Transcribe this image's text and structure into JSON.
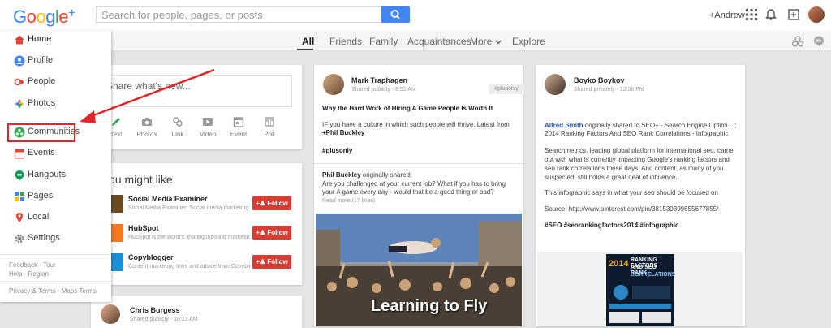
{
  "app": {
    "logo": "Google+",
    "logo_letters": [
      "G",
      "o",
      "o",
      "g",
      "l",
      "e",
      "+"
    ],
    "logo_colors": [
      "#4285f4",
      "#ea4335",
      "#fbbc05",
      "#4285f4",
      "#34a853",
      "#ea4335",
      "#4285f4"
    ]
  },
  "header": {
    "search_placeholder": "Search for people, pages, or posts",
    "username": "+Andrew"
  },
  "tabs": [
    "All",
    "Friends",
    "Family",
    "Acquaintances",
    "More",
    "Explore"
  ],
  "sidebar": {
    "items": [
      {
        "label": "Home",
        "icon": "home-icon",
        "color": "#db4437"
      },
      {
        "label": "Profile",
        "icon": "profile-icon",
        "color": "#4285f4"
      },
      {
        "label": "People",
        "icon": "people-icon",
        "color": "#db4437"
      },
      {
        "label": "Photos",
        "icon": "photos-icon",
        "color": "#34a853"
      },
      {
        "label": "Communities",
        "icon": "communities-icon",
        "color": "#34a853"
      },
      {
        "label": "Events",
        "icon": "events-icon",
        "color": "#db4437"
      },
      {
        "label": "Hangouts",
        "icon": "hangouts-icon",
        "color": "#0f9d58"
      },
      {
        "label": "Pages",
        "icon": "pages-icon",
        "color": "#4285f4"
      },
      {
        "label": "Local",
        "icon": "local-icon",
        "color": "#db4437"
      },
      {
        "label": "Settings",
        "icon": "settings-icon",
        "color": "#777777"
      }
    ],
    "footer": [
      "Feedback · Tour",
      "Help · Region",
      "Privacy & Terms · Maps Terms"
    ]
  },
  "share": {
    "placeholder": "Share what's new...",
    "tools": [
      "Text",
      "Photos",
      "Link",
      "Video",
      "Event",
      "Poll"
    ]
  },
  "suggestions": {
    "title": "You might like",
    "items": [
      {
        "name": "Social Media Examiner",
        "desc": "Social Media Examiner: Social media marketing",
        "action": "Follow"
      },
      {
        "name": "HubSpot",
        "desc": "HubSpot is the world's leading inbound marketing",
        "action": "Follow"
      },
      {
        "name": "Copyblogger",
        "desc": "Content marketing links and advice from Copyblogger",
        "action": "Follow"
      }
    ]
  },
  "bottom_post": {
    "author": "Chris Burgess",
    "meta": "Shared publicly  -  10:23 AM"
  },
  "post1": {
    "author": "Mark Traphagen",
    "meta": "Shared publicly  -  8:51 AM",
    "tag": "#plusonly",
    "title": "Why the Hard Work of Hiring A Game People Is Worth It",
    "line1": "IF you have a culture in which such people will thrive. Latest from",
    "line2": "+Phil Buckley",
    "hashtag": "#plusonly",
    "reshare_by": "Phil Buckley",
    "reshare_suffix": " originally shared:",
    "reshare_text1": "Are you challenged at your current job? What if you has to bring",
    "reshare_text2": "your A game every day - would that be a good thing or bad?",
    "read_more": "Read more (17 lines)",
    "photo_caption": "Learning to Fly"
  },
  "post2": {
    "author": "Boyko Boykov",
    "meta": "Shared privately  -  12:06 PM",
    "l1_name": "Alfred Smith",
    "l1_text": " originally shared to SEO+ - Search Engine Optimi... :",
    "l2": "2014 Ranking Factors And SEO Rank Correlations - Infographic",
    "p1": "Searchmetrics, leading global platform for international seo, came",
    "p2": "out with what is currently impacting Google's ranking factors and",
    "p3": "seo rank correlations these days. And content, as many of you",
    "p4": "suspected, still holds a great deal of influence.",
    "p5": "This infographic says  in what your seo should be focused on",
    "p6": "Source: http://www.pinterest.com/pin/381539399655677855/",
    "tags": "#SEO   #seorankingfactors2014   #infographic",
    "info_year": "2014",
    "info_title1": "RANKING FACTORS",
    "info_title2": "AND SEO RANK",
    "info_title3": "CORRELATIONS"
  }
}
